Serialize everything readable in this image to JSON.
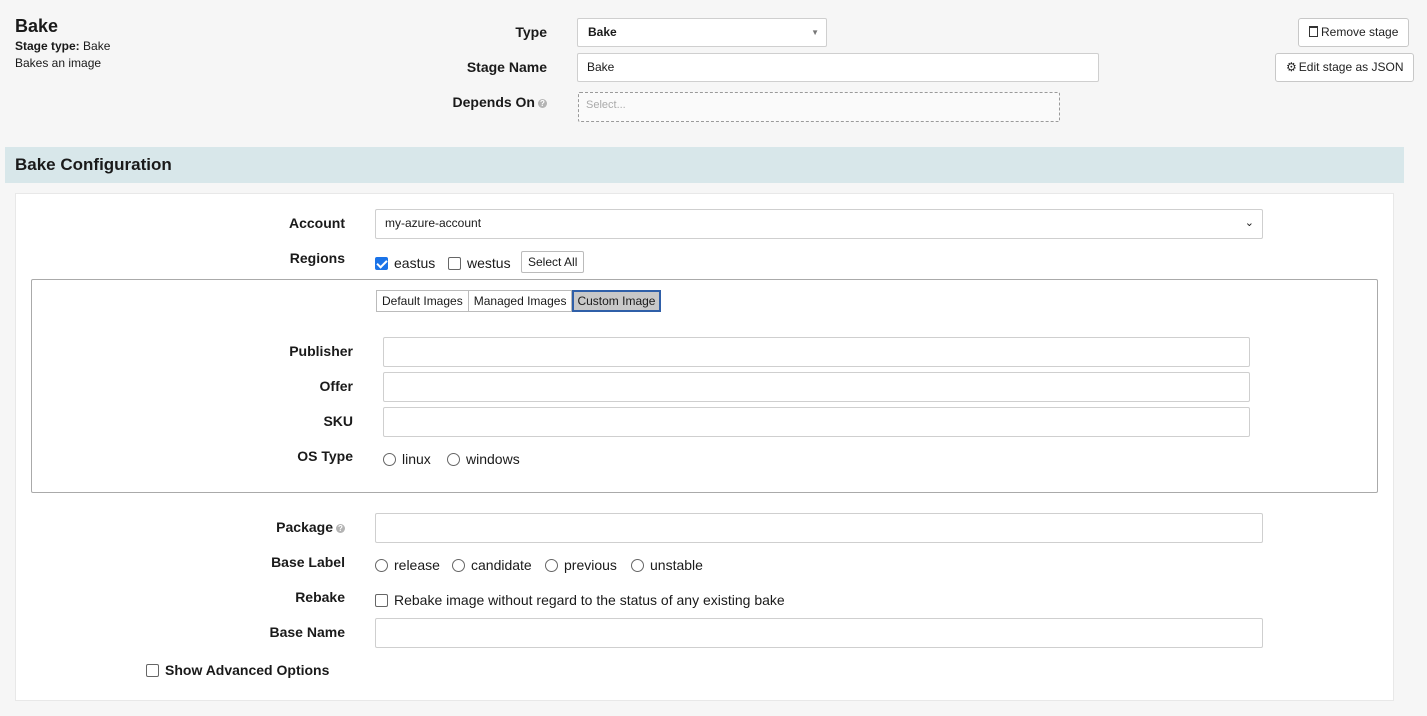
{
  "stage": {
    "title": "Bake",
    "type_label": "Stage type:",
    "type_value": "Bake",
    "description": "Bakes an image"
  },
  "form": {
    "type_label": "Type",
    "type_value": "Bake",
    "stage_name_label": "Stage Name",
    "stage_name_value": "Bake",
    "depends_on_label": "Depends On",
    "depends_on_placeholder": "Select..."
  },
  "actions": {
    "remove_stage": "Remove stage",
    "edit_json": "Edit stage as JSON"
  },
  "bake": {
    "section_title": "Bake Configuration",
    "account_label": "Account",
    "account_value": "my-azure-account",
    "regions_label": "Regions",
    "regions": [
      {
        "name": "eastus",
        "checked": true
      },
      {
        "name": "westus",
        "checked": false
      }
    ],
    "select_all": "Select All",
    "image_tabs": [
      "Default Images",
      "Managed Images",
      "Custom Image"
    ],
    "active_tab": "Custom Image",
    "publisher_label": "Publisher",
    "offer_label": "Offer",
    "sku_label": "SKU",
    "os_type_label": "OS Type",
    "os_types": [
      "linux",
      "windows"
    ],
    "package_label": "Package",
    "base_label_label": "Base Label",
    "base_labels": [
      "release",
      "candidate",
      "previous",
      "unstable"
    ],
    "rebake_label": "Rebake",
    "rebake_text": "Rebake image without regard to the status of any existing bake",
    "base_name_label": "Base Name",
    "show_advanced": "Show Advanced Options"
  },
  "colors": {
    "section_header_bg": "#d8e7ea",
    "checkbox_checked": "#1a73e8",
    "page_bg": "#f6f6f6"
  }
}
